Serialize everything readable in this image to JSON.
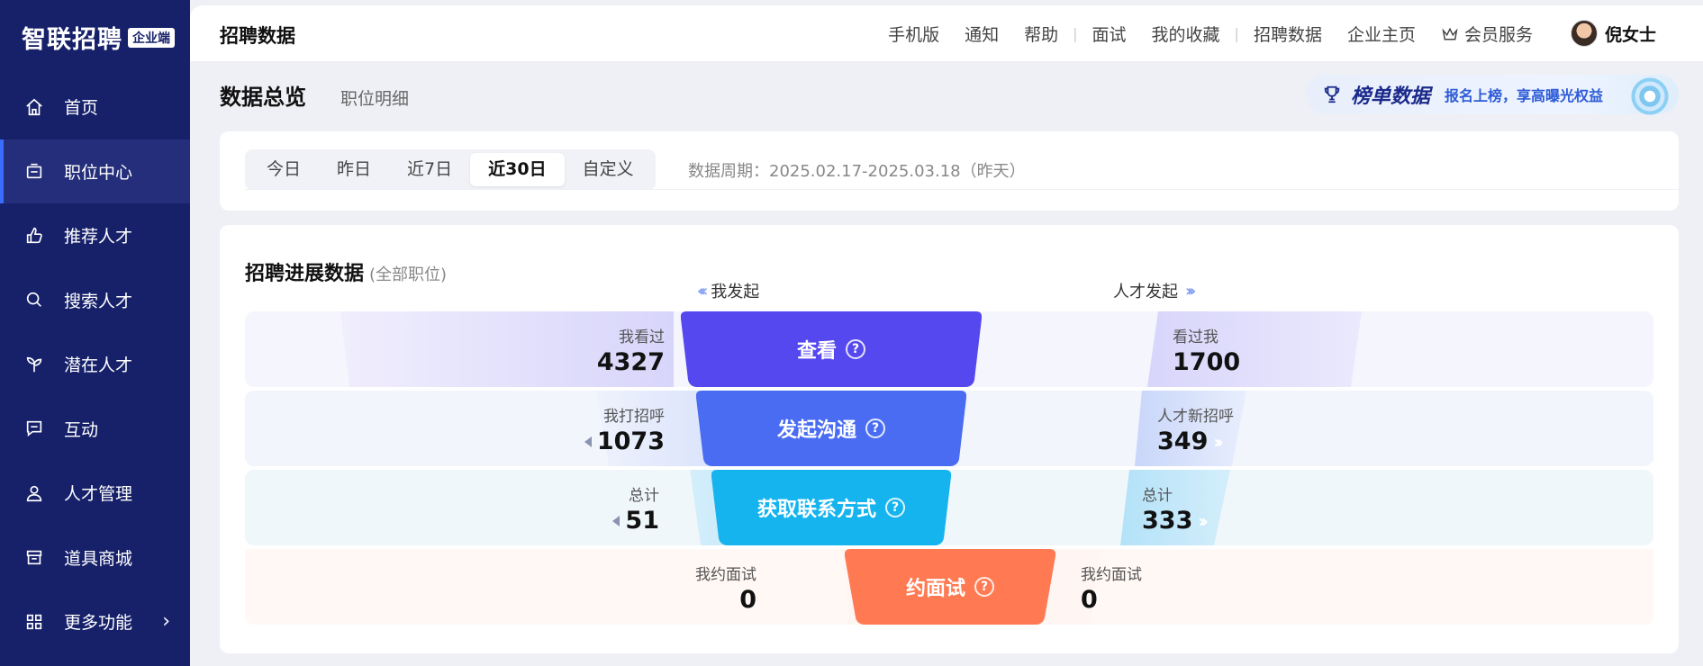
{
  "sidebar": {
    "logo": "智联招聘",
    "badge": "企业端",
    "items": [
      {
        "label": "首页",
        "icon": "home-icon"
      },
      {
        "label": "职位中心",
        "icon": "job-icon"
      },
      {
        "label": "推荐人才",
        "icon": "thumb-up-icon"
      },
      {
        "label": "搜索人才",
        "icon": "search-icon"
      },
      {
        "label": "潜在人才",
        "icon": "sprout-icon"
      },
      {
        "label": "互动",
        "icon": "chat-icon"
      },
      {
        "label": "人才管理",
        "icon": "people-icon"
      },
      {
        "label": "道具商城",
        "icon": "store-icon"
      },
      {
        "label": "更多功能",
        "icon": "grid-icon"
      }
    ]
  },
  "topbar": {
    "title": "招聘数据",
    "nav": [
      "手机版",
      "通知",
      "帮助",
      "面试",
      "我的收藏",
      "招聘数据",
      "企业主页",
      "会员服务"
    ],
    "user": "倪女士"
  },
  "header": {
    "title": "数据总览",
    "tab2": "职位明细"
  },
  "banner": {
    "title": "榜单数据",
    "subtitle": "报名上榜，享高曝光权益"
  },
  "filter": {
    "options": [
      "今日",
      "昨日",
      "近7日",
      "近30日",
      "自定义"
    ],
    "period": "数据周期：2025.02.17-2025.03.18（昨天）"
  },
  "progress": {
    "title": "招聘进展数据",
    "subtitle": "(全部职位)",
    "dir_left": "我发起",
    "dir_right": "人才发起",
    "rows": [
      {
        "center": "查看",
        "left_label": "我看过",
        "left_value": "4327",
        "right_label": "看过我",
        "right_value": "1700"
      },
      {
        "center": "发起沟通",
        "left_label": "我打招呼",
        "left_value": "1073",
        "right_label": "人才新招呼",
        "right_value": "349"
      },
      {
        "center": "获取联系方式",
        "left_label": "总计",
        "left_value": "51",
        "right_label": "总计",
        "right_value": "333"
      },
      {
        "center": "约面试",
        "left_label": "我约面试",
        "left_value": "0",
        "right_label": "我约面试",
        "right_value": "0"
      }
    ]
  },
  "colors": {
    "sidebar_bg": "#17216a",
    "funnel_1": "#5448ee",
    "funnel_2": "#4a6cf2",
    "funnel_3": "#16b4ee",
    "funnel_4": "#ff7a52"
  }
}
